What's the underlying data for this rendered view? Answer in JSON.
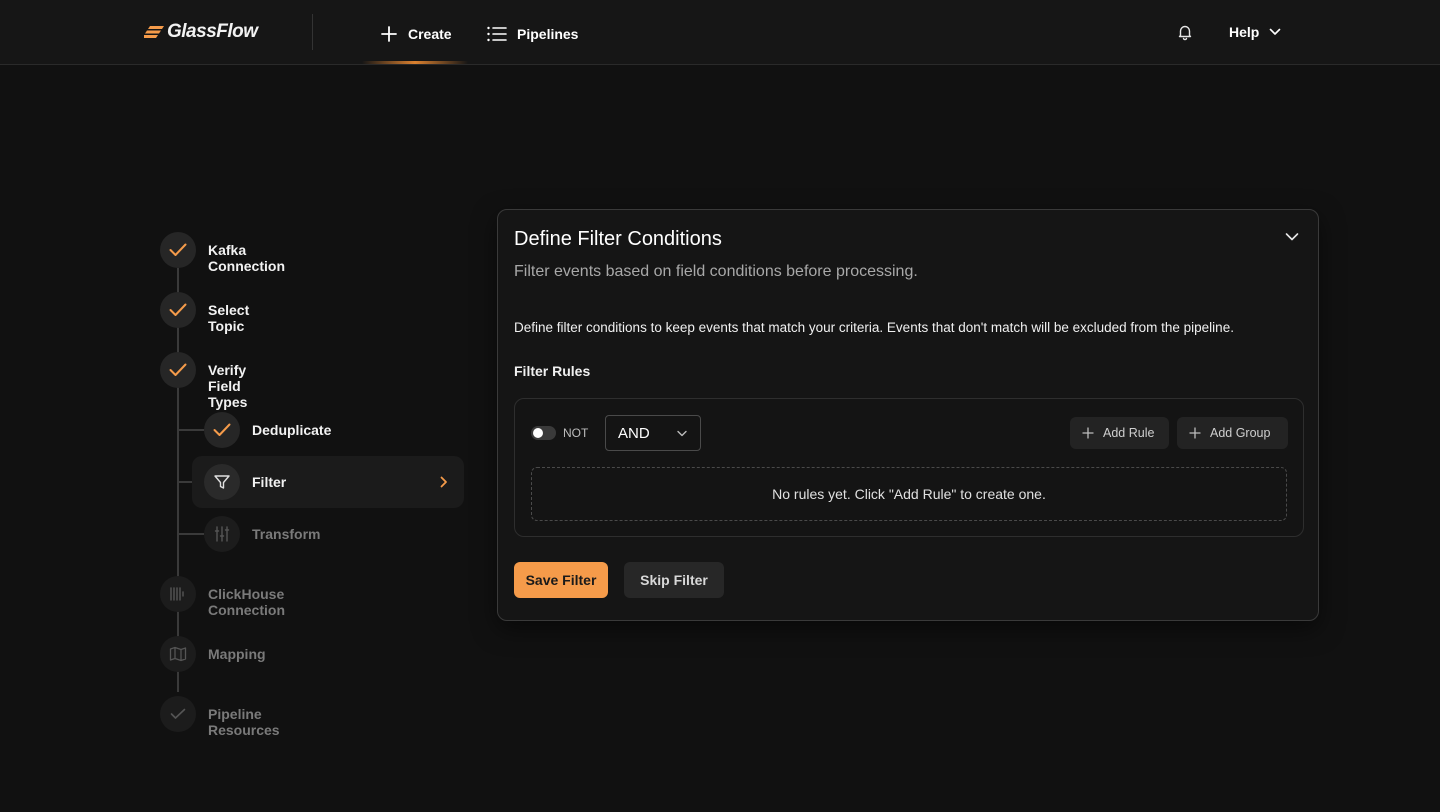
{
  "header": {
    "logo_text": "GlassFlow",
    "nav": [
      {
        "label": "Create",
        "icon": "plus-icon",
        "active": true
      },
      {
        "label": "Pipelines",
        "icon": "list-icon",
        "active": false
      }
    ],
    "help_label": "Help",
    "accent_color": "#f59b4a"
  },
  "steps": [
    {
      "label": "Kafka Connection",
      "status": "completed",
      "icon": "check-icon"
    },
    {
      "label": "Select Topic",
      "status": "completed",
      "icon": "check-icon"
    },
    {
      "label": "Verify Field Types",
      "status": "completed",
      "icon": "check-icon"
    },
    {
      "label": "Deduplicate",
      "status": "completed",
      "icon": "check-icon"
    },
    {
      "label": "Filter",
      "status": "active",
      "icon": "filter-icon"
    },
    {
      "label": "Transform",
      "status": "pending",
      "icon": "sliders-icon"
    },
    {
      "label": "ClickHouse Connection",
      "status": "pending",
      "icon": "database-icon"
    },
    {
      "label": "Mapping",
      "status": "pending",
      "icon": "map-icon"
    },
    {
      "label": "Pipeline Resources",
      "status": "pending",
      "icon": "check-icon"
    }
  ],
  "card": {
    "title": "Define Filter Conditions",
    "subtitle": "Filter events based on field conditions before processing.",
    "description": "Define filter conditions to keep events that match your criteria. Events that don't match will be excluded from the pipeline.",
    "rules_label": "Filter Rules",
    "not_label": "NOT",
    "not_enabled": false,
    "operator": "AND",
    "add_rule_label": "Add Rule",
    "add_group_label": "Add Group",
    "empty_text": "No rules yet. Click \"Add Rule\" to create one.",
    "save_label": "Save Filter",
    "skip_label": "Skip Filter"
  }
}
